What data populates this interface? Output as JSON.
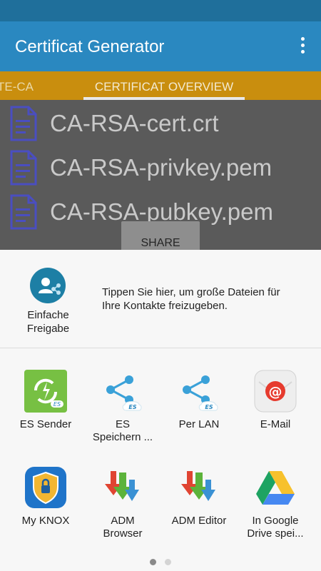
{
  "app": {
    "title": "Certificat Generator"
  },
  "tabs": {
    "left_partial": "TE-CA",
    "active": "CERTIFICAT OVERVIEW"
  },
  "files": [
    "CA-RSA-cert.crt",
    "CA-RSA-privkey.pem",
    "CA-RSA-pubkey.pem"
  ],
  "share_button": "SHARE",
  "share_sheet": {
    "quick_share": {
      "label_line1": "Einfache",
      "label_line2": "Freigabe",
      "text_line1": "Tippen Sie hier, um große Dateien für",
      "text_line2": "Ihre Kontakte freizugeben."
    },
    "apps": [
      {
        "line1": "ES Sender",
        "line2": "",
        "icon": "es-sender-icon"
      },
      {
        "line1": "ES",
        "line2": "Speichern ...",
        "icon": "es-save-icon"
      },
      {
        "line1": "Per LAN",
        "line2": "",
        "icon": "share-lan-icon"
      },
      {
        "line1": "E-Mail",
        "line2": "",
        "icon": "email-icon"
      },
      {
        "line1": "My KNOX",
        "line2": "",
        "icon": "knox-icon"
      },
      {
        "line1": "ADM",
        "line2": "Browser",
        "icon": "adm-browser-icon"
      },
      {
        "line1": "ADM Editor",
        "line2": "",
        "icon": "adm-editor-icon"
      },
      {
        "line1": "In Google",
        "line2": "Drive spei...",
        "icon": "google-drive-icon"
      }
    ],
    "page_indicator": {
      "current": 1,
      "total": 2
    }
  },
  "colors": {
    "status_bar": "#1f6f9b",
    "app_bar": "#2a88c0",
    "tab_bar": "#c98e0e",
    "dim_overlay": "#5a5a5a",
    "sheet_bg": "#f7f7f7"
  }
}
